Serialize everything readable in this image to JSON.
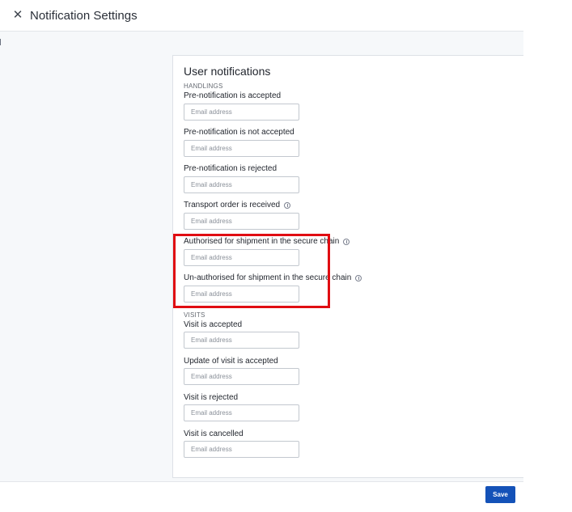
{
  "header": {
    "close_icon": "close-icon",
    "title": "Notification Settings"
  },
  "card": {
    "title": "User notifications",
    "sections": [
      {
        "label": "HANDLINGS",
        "fields": [
          {
            "label": "Pre-notification is accepted",
            "placeholder": "Email address",
            "info": false
          },
          {
            "label": "Pre-notification is not accepted",
            "placeholder": "Email address",
            "info": false
          },
          {
            "label": "Pre-notification is rejected",
            "placeholder": "Email address",
            "info": false
          },
          {
            "label": "Transport order is received",
            "placeholder": "Email address",
            "info": true
          },
          {
            "label": "Authorised for shipment in the secure chain",
            "placeholder": "Email address",
            "info": true
          },
          {
            "label": "Un-authorised for shipment in the secure chain",
            "placeholder": "Email address",
            "info": true
          }
        ]
      },
      {
        "label": "VISITS",
        "fields": [
          {
            "label": "Visit is accepted",
            "placeholder": "Email address",
            "info": false
          },
          {
            "label": "Update of visit is accepted",
            "placeholder": "Email address",
            "info": false
          },
          {
            "label": "Visit is rejected",
            "placeholder": "Email address",
            "info": false
          },
          {
            "label": "Visit is cancelled",
            "placeholder": "Email address",
            "info": false
          }
        ]
      }
    ]
  },
  "colors": {
    "highlight": "#e00d12",
    "primary": "#1452b8"
  },
  "footer": {
    "save_label": "Save"
  }
}
